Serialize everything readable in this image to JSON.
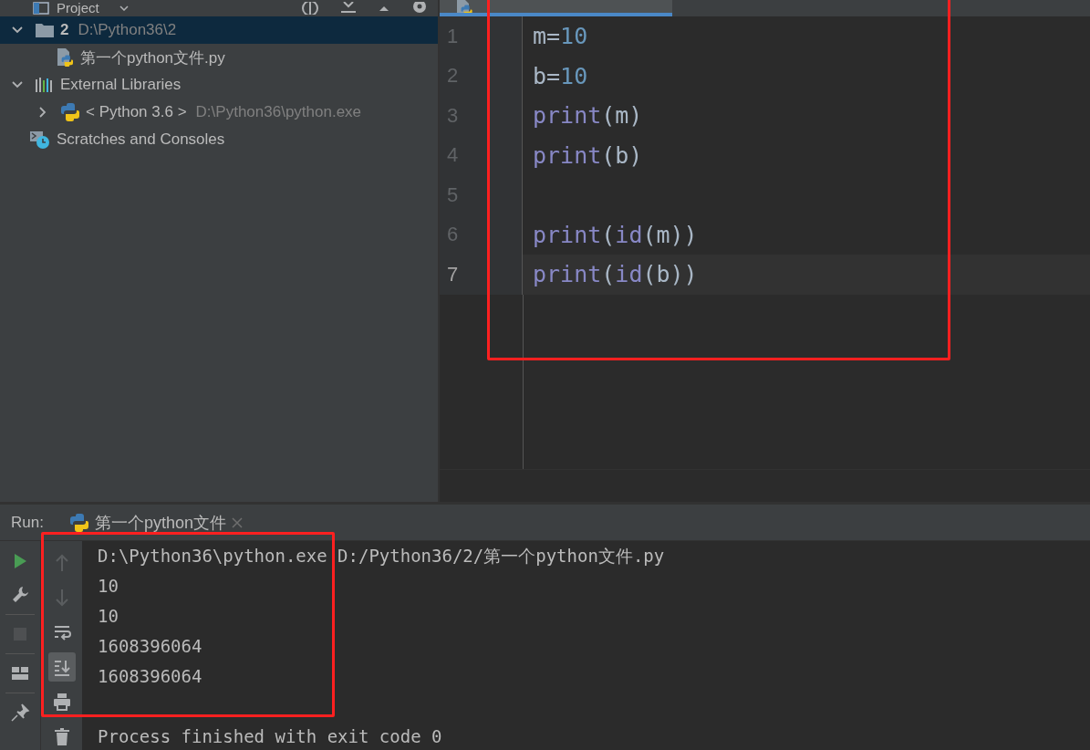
{
  "project_panel": {
    "title": "Project",
    "tree": [
      {
        "kind": "folder",
        "label": "2",
        "path": "D:\\Python36\\2",
        "expanded": true,
        "selected": true,
        "children": [
          {
            "kind": "python-file",
            "label": "第一个python文件.py",
            "selected": false
          }
        ]
      },
      {
        "kind": "libraries",
        "label": "External Libraries",
        "expanded": true,
        "selected": false,
        "children": [
          {
            "kind": "python-sdk",
            "label": "< Python 3.6 >",
            "path": "D:\\Python36\\python.exe",
            "expanded": false,
            "selected": false
          }
        ]
      },
      {
        "kind": "scratches",
        "label": "Scratches and Consoles",
        "selected": false
      }
    ]
  },
  "editor": {
    "highlighted": true,
    "tabs": [
      {
        "selected": true
      }
    ],
    "lines": [
      {
        "number": "1",
        "current": false,
        "tokens": [
          {
            "text": "m=",
            "kind": "plain"
          },
          {
            "text": "10",
            "kind": "number"
          }
        ]
      },
      {
        "number": "2",
        "current": false,
        "tokens": [
          {
            "text": "b=",
            "kind": "plain"
          },
          {
            "text": "10",
            "kind": "number"
          }
        ]
      },
      {
        "number": "3",
        "current": false,
        "tokens": [
          {
            "text": "print",
            "kind": "builtin"
          },
          {
            "text": "(m)",
            "kind": "plain"
          }
        ]
      },
      {
        "number": "4",
        "current": false,
        "tokens": [
          {
            "text": "print",
            "kind": "builtin"
          },
          {
            "text": "(b)",
            "kind": "plain"
          }
        ]
      },
      {
        "number": "5",
        "current": false
      },
      {
        "number": "6",
        "current": false,
        "tokens": [
          {
            "text": "print",
            "kind": "builtin"
          },
          {
            "text": "(",
            "kind": "plain"
          },
          {
            "text": "id",
            "kind": "builtin"
          },
          {
            "text": "(m))",
            "kind": "plain"
          }
        ]
      },
      {
        "number": "7",
        "current": true,
        "tokens": [
          {
            "text": "print",
            "kind": "builtin"
          },
          {
            "text": "(",
            "kind": "plain"
          },
          {
            "text": "id",
            "kind": "builtin"
          },
          {
            "text": "(b))",
            "kind": "plain"
          }
        ]
      }
    ]
  },
  "run_panel": {
    "label": "Run:",
    "highlighted": true,
    "tabs": [
      {
        "label": "第一个python文件",
        "selected": true
      }
    ],
    "stop_disabled": true,
    "scroll_to_end": true,
    "console": [
      {
        "kind": "command",
        "text": "D:\\Python36\\python.exe D:/Python36/2/第一个python文件.py"
      },
      {
        "kind": "output",
        "text": "10"
      },
      {
        "kind": "output",
        "text": "10"
      },
      {
        "kind": "output",
        "text": "1608396064"
      },
      {
        "kind": "output",
        "text": "1608396064"
      },
      {
        "kind": "status",
        "text": "Process finished with exit code 0"
      }
    ]
  }
}
